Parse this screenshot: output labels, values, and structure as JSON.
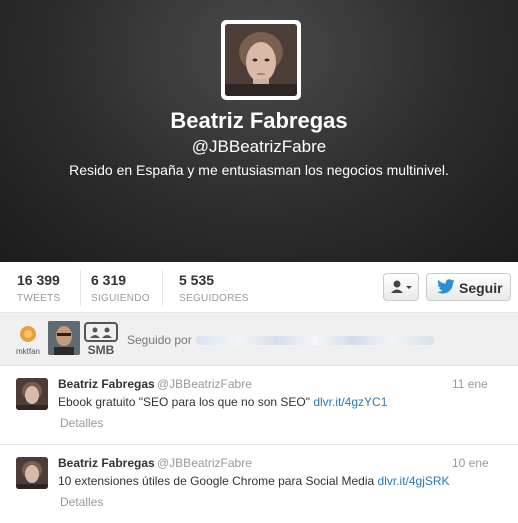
{
  "profile": {
    "name": "Beatriz Fabregas",
    "handle": "@JBBeatrizFabre",
    "bio": "Resido en España y me entusiasman los negocios multinivel."
  },
  "stats": [
    {
      "value": "16 399",
      "label": "TWEETS"
    },
    {
      "value": "6 319",
      "label": "SIGUIENDO"
    },
    {
      "value": "5 535",
      "label": "SEGUIDORES"
    }
  ],
  "actions": {
    "follow_label": "Seguir",
    "user_menu_icon": "user-dropdown-icon",
    "follow_icon": "twitter-bird-icon"
  },
  "followed_by": {
    "text": "Seguido por",
    "logos": [
      "mktfan",
      "SMB"
    ]
  },
  "tweets": [
    {
      "name": "Beatriz Fabregas",
      "handle": "@JBBeatrizFabre",
      "date": "11 ene",
      "text": "Ebook gratuito \"SEO para los que no son SEO\"",
      "link": "dlvr.it/4gzYC1",
      "details": "Detalles"
    },
    {
      "name": "Beatriz Fabregas",
      "handle": "@JBBeatrizFabre",
      "date": "10 ene",
      "text": "10 extensiones útiles de Google Chrome para Social Media",
      "link": "dlvr.it/4gjSRK",
      "details": "Detalles"
    }
  ],
  "colors": {
    "link": "#2a7ab8",
    "twitter_blue": "#2b8fd6",
    "header_dark": "#2c2c2c"
  }
}
